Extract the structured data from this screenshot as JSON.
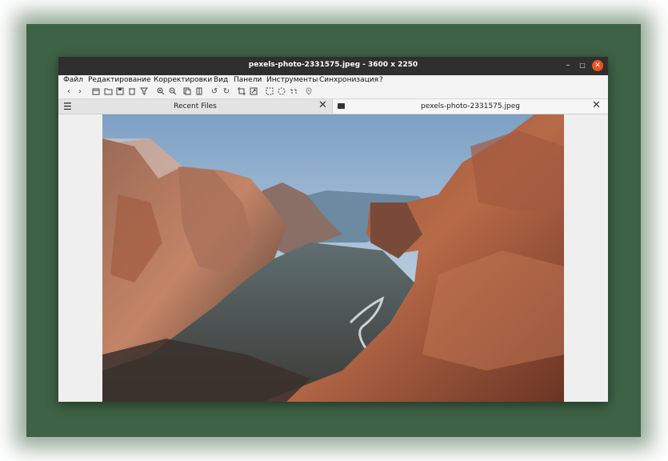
{
  "window": {
    "title": "pexels-photo-2331575.jpeg  - 3600 x 2250",
    "controls": {
      "minimize": "–",
      "maximize": "□",
      "close": "✕"
    }
  },
  "menu": {
    "items": [
      "Файл",
      "Редактирование",
      "Корректировки",
      "Вид",
      "Панели",
      "Инструменты",
      "Синхронизация",
      "?"
    ]
  },
  "toolbar": {
    "icons": [
      "arrow-left-icon",
      "arrow-right-icon",
      "new-window-icon",
      "open-folder-icon",
      "save-icon",
      "delete-icon",
      "filter-icon",
      "zoom-in-icon",
      "zoom-out-icon",
      "copy-icon",
      "paste-icon",
      "rotate-left-icon",
      "rotate-right-icon",
      "crop-icon",
      "resize-icon",
      "select-all-icon",
      "select-icon",
      "select-lasso-icon",
      "location-icon"
    ]
  },
  "tabs": {
    "left_label": "Recent Files",
    "right_label": "pexels-photo-2331575.jpeg"
  },
  "image": {
    "file": "pexels-photo-2331575.jpeg",
    "width": 3600,
    "height": 2250
  }
}
